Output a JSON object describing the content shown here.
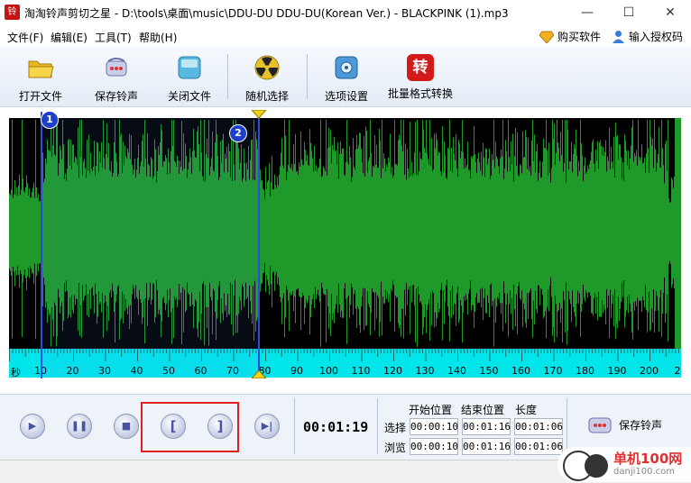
{
  "window": {
    "icon_text": "铃",
    "title": "淘淘铃声剪切之星 - D:\\tools\\桌面\\music\\DDU-DU DDU-DU(Korean Ver.) - BLACKPINK (1).mp3",
    "minimize": "—",
    "maximize": "☐",
    "close": "✕"
  },
  "menu": {
    "items": [
      "文件(F)",
      "编辑(E)",
      "工具(T)",
      "帮助(H)"
    ],
    "buy": "购买软件",
    "license": "输入授权码"
  },
  "toolbar": {
    "open": "打开文件",
    "save": "保存铃声",
    "close": "关闭文件",
    "random": "随机选择",
    "options": "选项设置",
    "batch": "批量格式转换",
    "batch_icon_char": "转"
  },
  "ruler": {
    "unit": "秒",
    "ticks": [
      "10",
      "20",
      "30",
      "40",
      "50",
      "60",
      "70",
      "80",
      "90",
      "100",
      "110",
      "120",
      "130",
      "140",
      "150",
      "160",
      "170",
      "180",
      "190",
      "200",
      "2"
    ]
  },
  "markers": {
    "start_label": "1",
    "end_label": "2"
  },
  "playback": {
    "current_time": "00:01:19"
  },
  "positions": {
    "header_start": "开始位置",
    "header_end": "结束位置",
    "header_length": "长度",
    "row_select": "选择",
    "row_browse": "浏览",
    "select": {
      "start": "00:00:10",
      "end": "00:01:16",
      "length": "00:01:06"
    },
    "browse": {
      "start": "00:00:10",
      "end": "00:01:16",
      "length": "00:01:06"
    }
  },
  "save_ringtone": "保存铃声",
  "watermark": {
    "name": "单机100网",
    "url": "danji100.com"
  },
  "colors": {
    "waveform": "#1f9a2a",
    "ruler": "#00e5ea",
    "marker": "#2b4bd8",
    "highlight": "#e02020"
  }
}
